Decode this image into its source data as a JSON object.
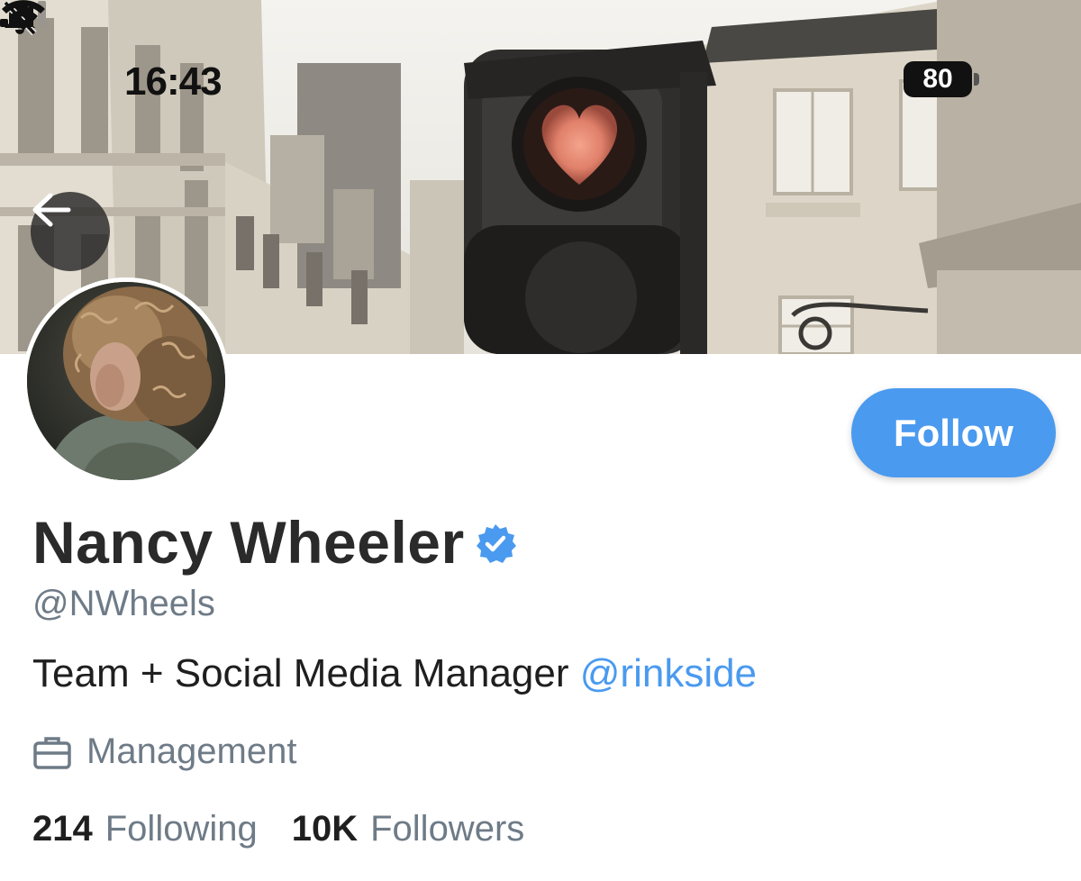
{
  "status_bar": {
    "time": "16:43",
    "battery_level": "80",
    "icons": [
      "bell-slash-icon",
      "cellular-signal-icon",
      "wifi-icon",
      "battery-icon"
    ]
  },
  "banner": {
    "description_icon": "banner-image"
  },
  "profile": {
    "display_name": "Nancy Wheeler",
    "verified": true,
    "handle": "@NWheels",
    "bio_text": "Team + Social Media Manager ",
    "bio_link": "@rinkside",
    "category": "Management",
    "following_count": "214",
    "following_label": "Following",
    "followers_count": "10K",
    "followers_label": "Followers"
  },
  "actions": {
    "follow_label": "Follow",
    "back_icon": "arrow-left-icon"
  },
  "colors": {
    "accent": "#4a9aef",
    "muted_text": "#6e7b87",
    "primary_text": "#2a2a2a"
  }
}
